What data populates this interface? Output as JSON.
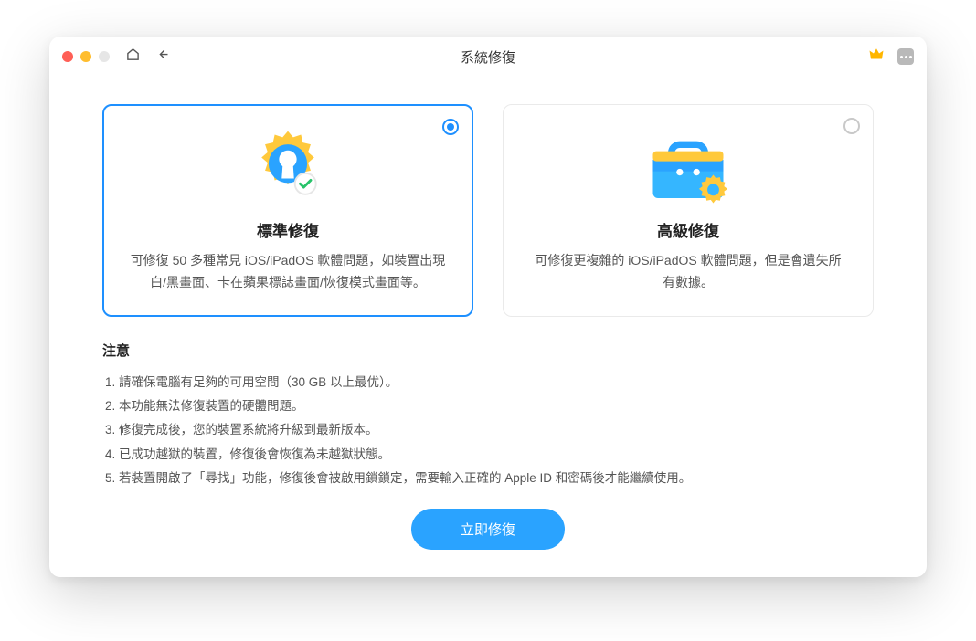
{
  "titlebar": {
    "title": "系統修復"
  },
  "cards": {
    "standard": {
      "title": "標準修復",
      "desc": "可修復 50 多種常見 iOS/iPadOS 軟體問題，如裝置出現白/黑畫面、卡在蘋果標誌畫面/恢復模式畫面等。",
      "selected": true
    },
    "advanced": {
      "title": "高級修復",
      "desc": "可修復更複雜的 iOS/iPadOS 軟體問題，但是會遺失所有數據。",
      "selected": false
    }
  },
  "notice": {
    "heading": "注意",
    "items": [
      "請確保電腦有足夠的可用空間（30 GB 以上最优）。",
      "本功能無法修復裝置的硬體問題。",
      "修復完成後，您的裝置系統將升級到最新版本。",
      "已成功越獄的裝置，修復後會恢復為未越獄狀態。",
      "若裝置開啟了「尋找」功能，修復後會被啟用鎖鎖定，需要輸入正確的 Apple ID 和密碼後才能繼續使用。"
    ]
  },
  "action": {
    "primary": "立即修復"
  }
}
